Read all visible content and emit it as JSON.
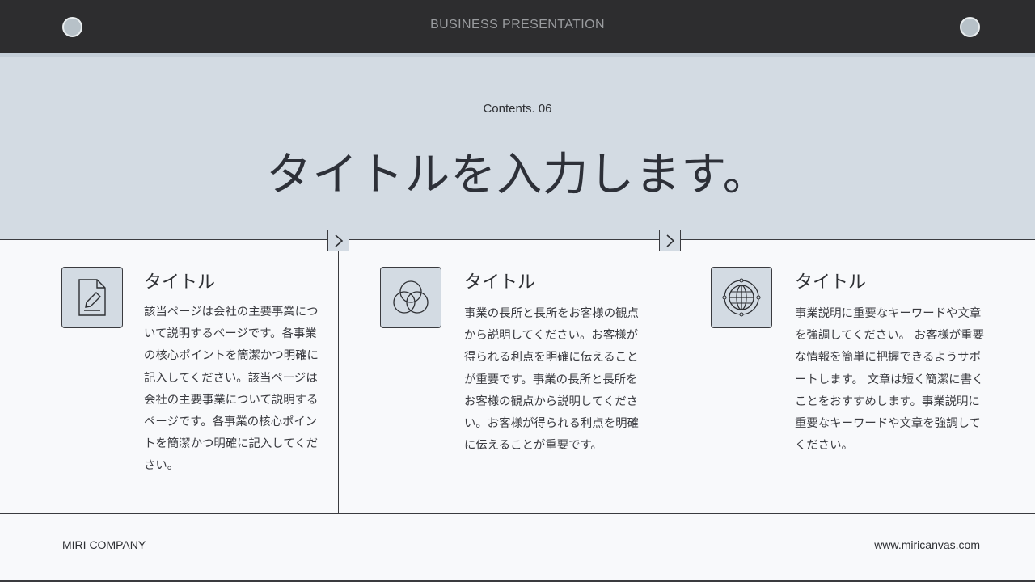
{
  "header": {
    "brand": "BUSINESS PRESENTATION",
    "accent_bg": "#2d2d2f",
    "dot_color": "#b7c1c8"
  },
  "hero": {
    "subtitle": "Contents. 06",
    "title": "タイトルを入力します。",
    "bg": "#d3dbe3"
  },
  "columns": [
    {
      "icon": "document-edit-icon",
      "title": "タイトル",
      "lines": [
        "該当ページは会社の主要事業につ",
        "いて説明するページです。各事業",
        "の核心ポイントを簡潔かつ明確に",
        "記入してください。該当ページは",
        "会社の主要事業について説明する",
        "ページです。各事業の核心ポイン",
        "トを簡潔かつ明確に記入してくだ",
        "さい。"
      ]
    },
    {
      "icon": "venn-circles-icon",
      "title": "タイトル",
      "lines": [
        "事業の長所と長所をお客様の観点",
        "から説明してください。お客様が",
        "得られる利点を明確に伝えること",
        "が重要です。事業の長所と長所を",
        "お客様の観点から説明してくださ",
        "い。お客様が得られる利点を明確",
        "に伝えることが重要です。"
      ]
    },
    {
      "icon": "globe-icon",
      "title": "タイトル",
      "lines": [
        "事業説明に重要なキーワードや文章",
        "を強調してください。 お客様が重要",
        "な情報を簡単に把握できるようサポ",
        "ートします。 文章は短く簡潔に書く",
        "ことをおすすめします。事業説明に",
        "重要なキーワードや文章を強調して",
        "ください。"
      ]
    }
  ],
  "arrows": [
    "chevron-right-icon",
    "chevron-right-icon"
  ],
  "footer": {
    "company": "MIRI COMPANY",
    "website": "www.miricanvas.com"
  }
}
